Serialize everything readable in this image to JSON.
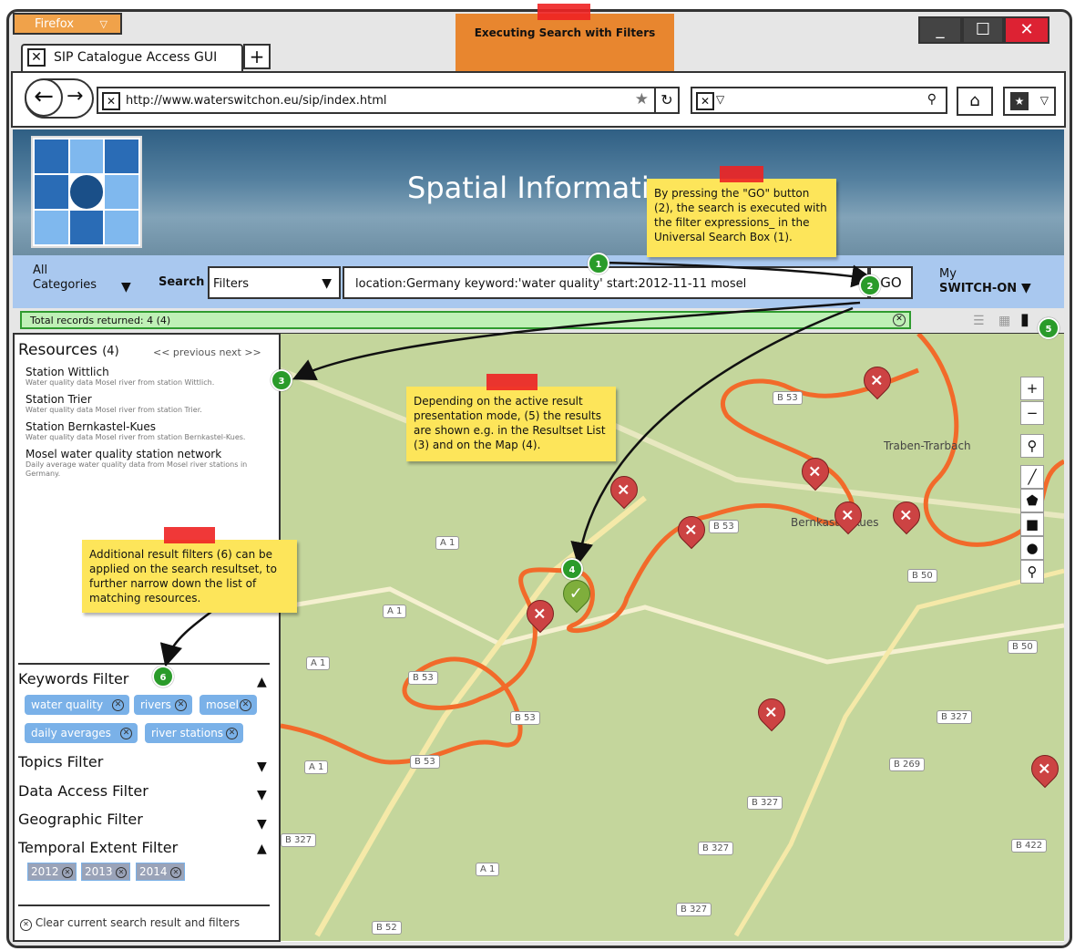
{
  "browser": {
    "app_label": "Firefox",
    "tab_title": "SIP Catalogue Access GUI",
    "url": "http://www.waterswitchon.eu/sip/index.html"
  },
  "sticky_top": "Executing Search with Filters",
  "banner": {
    "title": "Spatial Informatio"
  },
  "searchbar": {
    "category_line1": "All",
    "category_line2": "Categories",
    "search_label": "Search",
    "filter_select": "Filters",
    "query": "location:Germany keyword:'water quality' start:2012-11-11 mosel",
    "go_label": "GO",
    "my_line1": "My",
    "my_line2": "SWITCH-ON"
  },
  "status": {
    "text": "Total records returned: 4 (4)"
  },
  "resources": {
    "heading": "Resources",
    "count": "(4)",
    "pager": "<< previous   next >>",
    "items": [
      {
        "title": "Station Wittlich",
        "desc": "Water quality data Mosel river from station Wittlich."
      },
      {
        "title": "Station Trier",
        "desc": "Water quality data Mosel river from station Trier."
      },
      {
        "title": "Station Bernkastel-Kues",
        "desc": "Water quality data Mosel river from station Bernkastel-Kues."
      },
      {
        "title": "Mosel water quality station network",
        "desc": "Daily average water quality data from Mosel river stations in Germany."
      }
    ]
  },
  "filters": {
    "keywords": "Keywords Filter",
    "keyword_chips": [
      "water quality",
      "rivers",
      "mosel",
      "daily averages",
      "river stations"
    ],
    "topics": "Topics Filter",
    "data_access": "Data Access Filter",
    "geographic": "Geographic Filter",
    "temporal": "Temporal Extent Filter",
    "year_chips": [
      "2012",
      "2013",
      "2014"
    ],
    "clear": "Clear current search result and filters"
  },
  "notes": {
    "go_note": "By pressing the \"GO\" button (2), the search is executed with the filter expressions_ in the Universal Search Box (1).",
    "result_note": "Depending on the active result presentation mode, (5) the results are shown e.g. in the Resultset List (3) and on the Map (4).",
    "filter_note": "Additional result filters (6) can be applied on the search resultset, to further narrow down the list of matching resources."
  },
  "badges": [
    "1",
    "2",
    "3",
    "4",
    "5",
    "6"
  ],
  "map": {
    "towns": [
      "Traben-Trarbach",
      "Bernkastel-Kues"
    ],
    "roads": [
      "B 53",
      "B 53",
      "A 1",
      "A 1",
      "A 1",
      "B 50",
      "B 50",
      "B 327",
      "B 269",
      "B 327",
      "B 327",
      "B 327",
      "B 422",
      "B 52",
      "A 1",
      "B 53",
      "B 53",
      "B 53",
      "A 1",
      "B 327"
    ]
  },
  "colors": {
    "accent": "#a9c8ef",
    "status_bg": "#bff0b6",
    "note": "#fde55a",
    "river": "#f26a2a",
    "pin": "#cc4343"
  }
}
